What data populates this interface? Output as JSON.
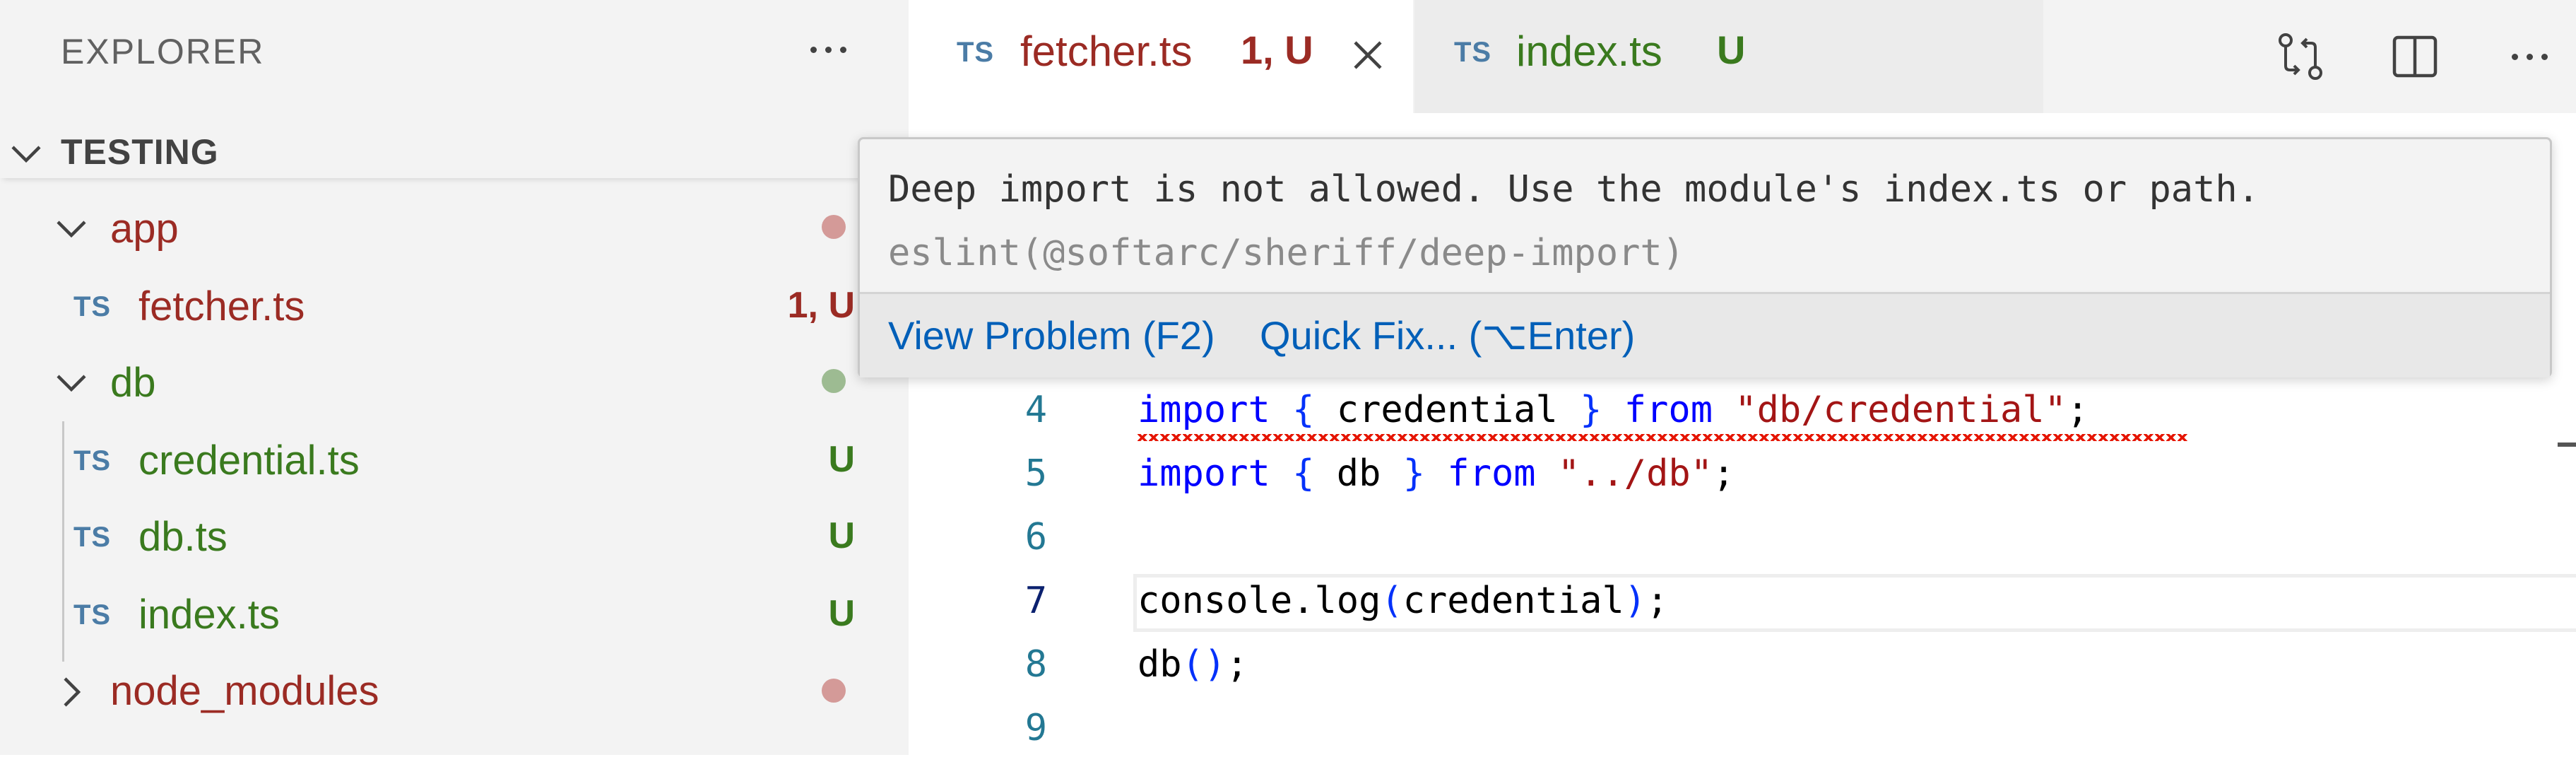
{
  "sidebar": {
    "title": "EXPLORER",
    "section_title": "TESTING",
    "items": [
      {
        "kind": "folder",
        "label": "app",
        "color": "#9b2b24",
        "dot_color": "#d49a98"
      },
      {
        "kind": "file",
        "badge": "TS",
        "label": "fetcher.ts",
        "decoration": "1, U",
        "color": "#9b2b24"
      },
      {
        "kind": "folder",
        "label": "db",
        "color": "#3a7a1e",
        "dot_color": "#9dbb92"
      },
      {
        "kind": "file",
        "badge": "TS",
        "label": "credential.ts",
        "decoration": "U",
        "color": "#3a7a1e"
      },
      {
        "kind": "file",
        "badge": "TS",
        "label": "db.ts",
        "decoration": "U",
        "color": "#3a7a1e"
      },
      {
        "kind": "file",
        "badge": "TS",
        "label": "index.ts",
        "decoration": "U",
        "color": "#3a7a1e"
      },
      {
        "kind": "folder-collapsed",
        "label": "node_modules",
        "color": "#9b2b24",
        "dot_color": "#d49a98"
      }
    ]
  },
  "tabs": [
    {
      "badge": "TS",
      "label": "fetcher.ts",
      "decoration": "1, U",
      "active": true
    },
    {
      "badge": "TS",
      "label": "index.ts",
      "decoration": "U",
      "active": false
    }
  ],
  "editor": {
    "lines": [
      {
        "num": "4",
        "tokens": [
          {
            "t": "import",
            "c": "kw"
          },
          {
            "t": " "
          },
          {
            "t": "{",
            "c": "brace"
          },
          {
            "t": " credential "
          },
          {
            "t": "}",
            "c": "brace"
          },
          {
            "t": " "
          },
          {
            "t": "from",
            "c": "kw"
          },
          {
            "t": " "
          },
          {
            "t": "\"db/credential\"",
            "c": "str"
          },
          {
            "t": ";"
          }
        ],
        "error": true
      },
      {
        "num": "5",
        "tokens": [
          {
            "t": "import",
            "c": "kw"
          },
          {
            "t": " "
          },
          {
            "t": "{",
            "c": "brace"
          },
          {
            "t": " db "
          },
          {
            "t": "}",
            "c": "brace"
          },
          {
            "t": " "
          },
          {
            "t": "from",
            "c": "kw"
          },
          {
            "t": " "
          },
          {
            "t": "\"../db\"",
            "c": "str"
          },
          {
            "t": ";"
          }
        ]
      },
      {
        "num": "6",
        "tokens": []
      },
      {
        "num": "7",
        "tokens": [
          {
            "t": "console.log"
          },
          {
            "t": "(",
            "c": "brace"
          },
          {
            "t": "credential"
          },
          {
            "t": ")",
            "c": "brace"
          },
          {
            "t": ";"
          }
        ],
        "current": true
      },
      {
        "num": "8",
        "tokens": [
          {
            "t": "db"
          },
          {
            "t": "()",
            "c": "brace"
          },
          {
            "t": ";"
          }
        ]
      },
      {
        "num": "9",
        "tokens": []
      }
    ]
  },
  "hover": {
    "message": "Deep import is not allowed. Use the module's index.ts or path.",
    "source": "eslint(@softarc/sheriff/deep-import)",
    "view_problem": "View Problem (F2)",
    "quick_fix": "Quick Fix... (⌥Enter)"
  }
}
